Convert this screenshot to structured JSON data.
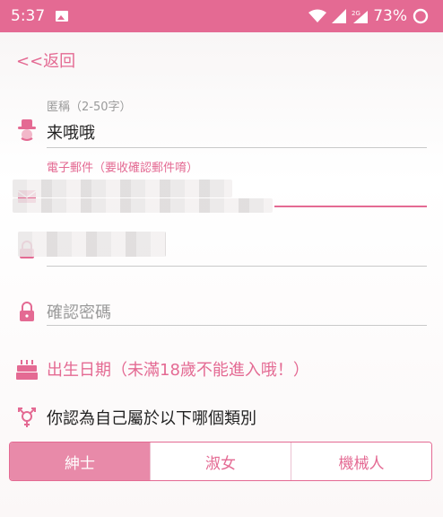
{
  "status_bar": {
    "time": "5:37",
    "battery": "73%"
  },
  "back_label": "<<返回",
  "nickname": {
    "label": "匿稱（2-50字）",
    "value": "来哦哦"
  },
  "email": {
    "label": "電子郵件（要收確認郵件唷）"
  },
  "confirm_password": {
    "placeholder": "確認密碼"
  },
  "birthday": {
    "label": "出生日期（未滿18歲不能進入哦！）"
  },
  "category": {
    "prompt": "你認為自己屬於以下哪個類別",
    "options": [
      "紳士",
      "淑女",
      "機械人"
    ],
    "selected": "紳士"
  },
  "colors": {
    "accent": "#e46a93",
    "accent_light": "#e88aa9"
  }
}
